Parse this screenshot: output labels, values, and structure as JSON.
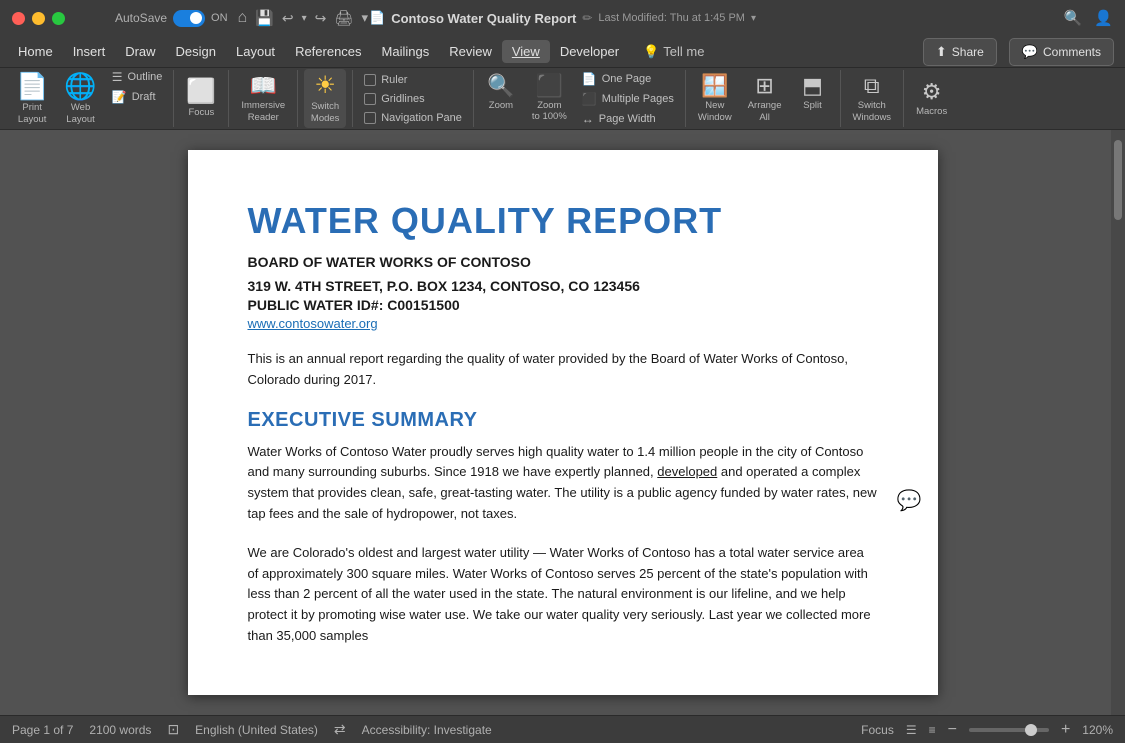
{
  "titlebar": {
    "autosave_label": "AutoSave",
    "autosave_state": "ON",
    "doc_title": "Contoso Water Quality Report",
    "modified_label": "Last Modified: Thu at 1:45 PM"
  },
  "menubar": {
    "items": [
      {
        "id": "home",
        "label": "Home"
      },
      {
        "id": "insert",
        "label": "Insert"
      },
      {
        "id": "draw",
        "label": "Draw"
      },
      {
        "id": "design",
        "label": "Design"
      },
      {
        "id": "layout",
        "label": "Layout"
      },
      {
        "id": "references",
        "label": "References"
      },
      {
        "id": "mailings",
        "label": "Mailings"
      },
      {
        "id": "review",
        "label": "Review"
      },
      {
        "id": "view",
        "label": "View",
        "active": true
      },
      {
        "id": "developer",
        "label": "Developer"
      },
      {
        "id": "tell_me",
        "label": "Tell me"
      }
    ]
  },
  "ribbon": {
    "groups": {
      "views": {
        "print_layout": "Print\nLayout",
        "web_layout": "Web\nLayout",
        "outline": "Outline",
        "draft": "Draft"
      },
      "focus": {
        "label": "Focus"
      },
      "immersive": {
        "label": "Immersive\nReader"
      },
      "switch": {
        "label": "Switch\nModes"
      },
      "show": {
        "ruler": "Ruler",
        "gridlines": "Gridlines",
        "navigation": "Navigation Pane"
      },
      "zoom": {
        "zoom_label": "Zoom",
        "zoom_100": "Zoom\nto 100%",
        "one_page": "One Page",
        "multiple_pages": "Multiple Pages",
        "page_width": "Page Width"
      },
      "window": {
        "new_window": "New\nWindow",
        "arrange_all": "Arrange\nAll",
        "split": "Split"
      },
      "switch_windows": {
        "label": "Switch\nWindows"
      },
      "macros": {
        "label": "Macros"
      }
    },
    "share_btn": "Share",
    "comments_btn": "Comments"
  },
  "document": {
    "title": "WATER QUALITY REPORT",
    "subtitle": "BOARD OF WATER WORKS OF CONTOSO",
    "address_line1": "319 W. 4TH STREET, P.O. BOX 1234, CONTOSO, CO 123456",
    "address_line2": "PUBLIC WATER ID#: C00151500",
    "website": "www.contosowater.org",
    "intro": "This is an annual report regarding the quality of water provided by the Board of Water Works of Contoso, Colorado during 2017.",
    "exec_summary_title": "EXECUTIVE SUMMARY",
    "exec_summary_p1": "Water Works of Contoso Water proudly serves high quality water to 1.4 million people in the city of Contoso and many surrounding suburbs. Since 1918 we have expertly planned, developed and operated a complex system that provides clean, safe, great-tasting water. The utility is a public agency funded by water rates, new tap fees and the sale of hydropower, not taxes.",
    "exec_summary_p2": "We are Colorado's oldest and largest water utility — Water Works of Contoso has a total water service area of approximately 300 square miles. Water Works of Contoso serves 25 percent of the state's population with less than 2 percent of all the water used in the state. The natural environment is our lifeline, and we help protect it by promoting wise water use. We take our water quality very seriously. Last year we collected more than 35,000 samples"
  },
  "statusbar": {
    "page": "Page 1 of 7",
    "words": "2100 words",
    "language": "English (United States)",
    "accessibility": "Accessibility: Investigate",
    "focus": "Focus",
    "zoom": "120%"
  }
}
